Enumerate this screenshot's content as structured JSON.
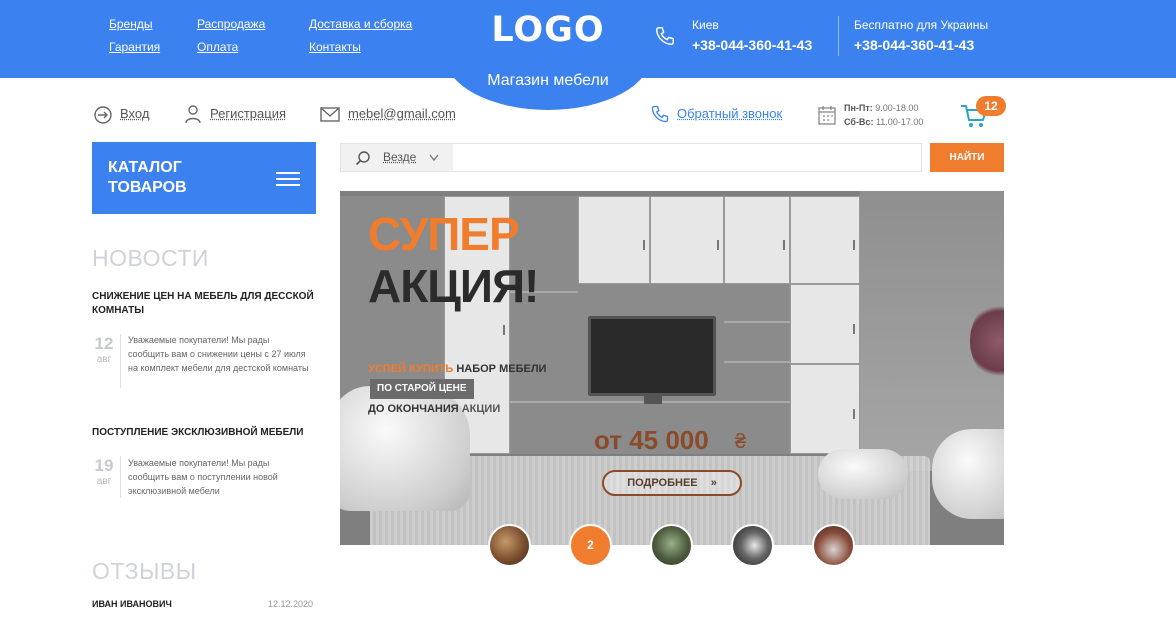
{
  "header": {
    "links": [
      "Бренды",
      "Гарантия",
      "Распродажа",
      "Оплата",
      "Доставка и сборка",
      "Контакты"
    ],
    "logo": "LOGO",
    "tagline": "Магазин мебели",
    "city": "Киев",
    "city_phone": "+38-044-360-41-43",
    "free_label": "Бесплатно для Украины",
    "free_phone": "+38-044-360-41-43",
    "accent_color": "#3b82f0",
    "orange_color": "#f07c2e"
  },
  "subbar": {
    "login": "Вход",
    "register": "Регистрация",
    "email": "mebel@gmail.com",
    "callback": "Обратный звонок",
    "schedule_weekdays_label": "Пн-Пт:",
    "schedule_weekdays": "9.00-18.00",
    "schedule_weekend_label": "Сб-Вс:",
    "schedule_weekend": "11.00-17.00",
    "cart_count": "12"
  },
  "catalog": {
    "label": "КАТАЛОГ ТОВАРОВ"
  },
  "search": {
    "scope": "Везде",
    "value": "",
    "button": "НАЙТИ"
  },
  "news": {
    "title": "НОВОСТИ",
    "items": [
      {
        "title": "Снижение цен на мебель для десской комнаты",
        "day": "12",
        "month": "авг",
        "text": "Уважаемые покупатели! Мы рады сообщить вам о снижении цены с 27 июля на комплект мебели для дестской комнаты"
      },
      {
        "title": "Поступление эксклюзивной мебели",
        "day": "19",
        "month": "авг",
        "text": "Уважаемые покупатели! Мы рады сообщить вам о поступлении новой эксклюзивной мебели"
      }
    ]
  },
  "reviews": {
    "title": "ОТЗЫВЫ",
    "items": [
      {
        "name": "ИВАН ИВАНОВИЧ",
        "date": "12.12.2020"
      }
    ]
  },
  "banner": {
    "super": "СУПЕР",
    "action": "АКЦИЯ!",
    "line1_orange": "УСПЕЙ КУПИТЬ",
    "line1_rest": "НАБОР МЕБЕЛИ",
    "tag": "ПО СТАРОЙ ЦЕНЕ",
    "line3_a": "ДО ОКОНЧАНИЯ",
    "line3_b": "АКЦИИ",
    "price": "от 45 000",
    "currency": "₴",
    "more": "ПОДРОБНЕЕ",
    "more_arrow": "»"
  },
  "slider": {
    "active_index": 2,
    "active_label": "2",
    "count": 5
  }
}
